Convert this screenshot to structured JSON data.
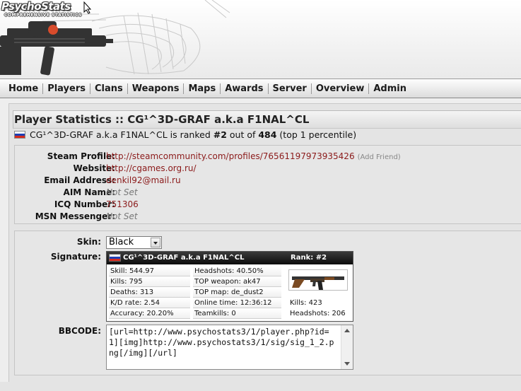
{
  "logo": {
    "title": "PsychoStats",
    "subtitle": "COMPREHENSIVE STATISTICS"
  },
  "nav": [
    "Home",
    "Players",
    "Clans",
    "Weapons",
    "Maps",
    "Awards",
    "Server",
    "Overview",
    "Admin"
  ],
  "page": {
    "title": "Player Statistics :: CG¹^3D-GRAF a.k.a F1NAL^CL",
    "player_name": "CG¹^3D-GRAF a.k.a F1NAL^CL",
    "rank_prefix": " is ranked ",
    "rank": "#2",
    "rank_middle": " out of ",
    "total": "484",
    "percentile": " (top 1 percentile)"
  },
  "profile": {
    "steam_label": "Steam Profile:",
    "steam_value": "http://steamcommunity.com/profiles/76561197973935426",
    "add_friend": "(Add Friend)",
    "website_label": "Website:",
    "website_value": "http://cgames.org.ru/",
    "email_label": "Email Address:",
    "email_value": "denkil92@mail.ru",
    "aim_label": "AIM Name:",
    "aim_value": "Not Set",
    "icq_label": "ICQ Number:",
    "icq_value": "751306",
    "msn_label": "MSN Messenger:",
    "msn_value": "Not Set"
  },
  "signature": {
    "skin_label": "Skin:",
    "skin_value": "Black",
    "signature_label": "Signature:",
    "header_name": "CG¹^3D-GRAF a.k.a F1NAL^CL",
    "header_rank": "Rank: #2",
    "col1": [
      "Skill: 544.97",
      "Kills: 795",
      "Deaths: 313",
      "K/D rate: 2.54",
      "Accuracy: 20.20%"
    ],
    "col2": [
      "Headshots: 40.50%",
      "TOP weapon: ak47",
      "TOP map: de_dust2",
      "Online time: 12:36:12",
      "Teamkills: 0"
    ],
    "col3": [
      "Kills: 423",
      "Headshots: 206"
    ],
    "weapon_icon": "ak47-rifle-icon",
    "bbcode_label": "BBCODE:",
    "bbcode_value": "[url=http://www.psychostats3/1/player.php?id=1][img]http://www.psychostats3/1/sig/sig_1_2.png[/img][/url]"
  },
  "colors": {
    "link": "#8b1a1a",
    "notset": "#777777",
    "background": "#eeeeee"
  }
}
